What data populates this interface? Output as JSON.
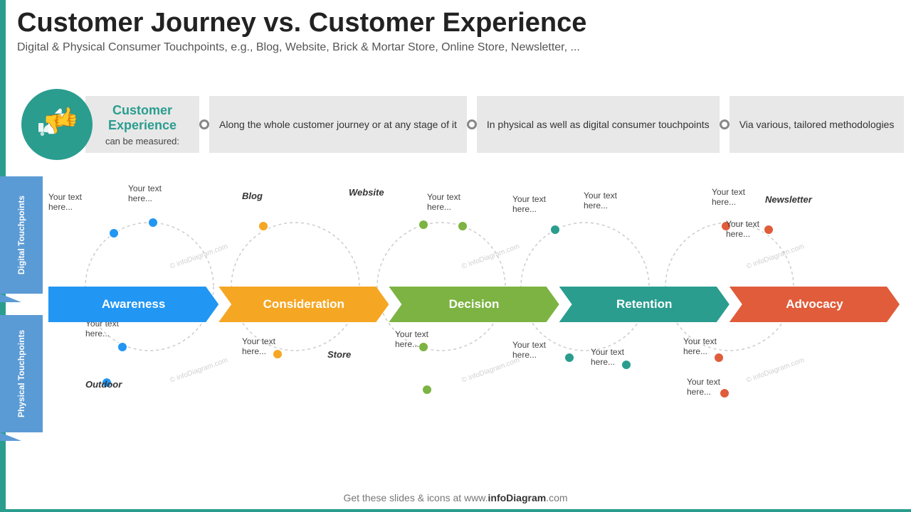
{
  "header": {
    "title": "Customer Journey vs. Customer Experience",
    "subtitle": "Digital & Physical Consumer Touchpoints, e.g., Blog, Website, Brick & Mortar Store, Online Store, Newsletter, ..."
  },
  "cx_section": {
    "icon_label": "thumbs up/down icon",
    "label_main": "Customer Experience",
    "label_sub": "can be measured:",
    "info_boxes": [
      "Along the whole customer journey or at any stage of it",
      "In physical as well as digital consumer touchpoints",
      "Via various, tailored methodologies"
    ]
  },
  "stages": [
    {
      "label": "Awareness",
      "color": "#2196f3"
    },
    {
      "label": "Consideration",
      "color": "#f5a623"
    },
    {
      "label": "Decision",
      "color": "#7cb342"
    },
    {
      "label": "Retention",
      "color": "#2a9d8f"
    },
    {
      "label": "Advocacy",
      "color": "#e05c3a"
    }
  ],
  "side_labels": {
    "digital": "Digital Touchpoints",
    "physical": "Physical Touchpoints"
  },
  "digital_touchpoints": {
    "items": [
      {
        "label": "Your text here...",
        "dot_color": "dot-blue",
        "italic": ""
      },
      {
        "label": "Your text here...",
        "dot_color": "dot-blue",
        "italic": ""
      },
      {
        "label": "Blog",
        "dot_color": "dot-orange",
        "italic": true
      },
      {
        "label": "Website",
        "dot_color": "dot-green",
        "italic": true
      },
      {
        "label": "Your text here...",
        "dot_color": "dot-green",
        "italic": ""
      },
      {
        "label": "Your text here...",
        "dot_color": "dot-teal",
        "italic": ""
      },
      {
        "label": "Your text here...",
        "dot_color": "dot-red",
        "italic": ""
      },
      {
        "label": "Newsletter",
        "dot_color": "dot-red",
        "italic": true
      },
      {
        "label": "Your text here...",
        "dot_color": "dot-red",
        "italic": ""
      }
    ]
  },
  "physical_touchpoints": {
    "items": [
      {
        "label": "Your text here...",
        "dot_color": "dot-blue",
        "italic": ""
      },
      {
        "label": "Outdoor",
        "dot_color": "dot-blue",
        "italic": true
      },
      {
        "label": "Your text here...",
        "dot_color": "dot-orange",
        "italic": ""
      },
      {
        "label": "Store",
        "dot_color": "dot-green",
        "italic": true
      },
      {
        "label": "Your text here...",
        "dot_color": "dot-green",
        "italic": ""
      },
      {
        "label": "Your text here...",
        "dot_color": "dot-teal",
        "italic": ""
      },
      {
        "label": "Your text here...",
        "dot_color": "dot-teal",
        "italic": ""
      },
      {
        "label": "Your text here...",
        "dot_color": "dot-red",
        "italic": ""
      },
      {
        "label": "Your text here...",
        "dot_color": "dot-red",
        "italic": ""
      }
    ]
  },
  "footer": {
    "text": "Get these slides & icons at www.",
    "brand": "infoDiagram",
    "suffix": ".com"
  },
  "watermarks": [
    "© infoDiagram.com",
    "© infoDiagram.com",
    "© infoDiagram.com"
  ]
}
